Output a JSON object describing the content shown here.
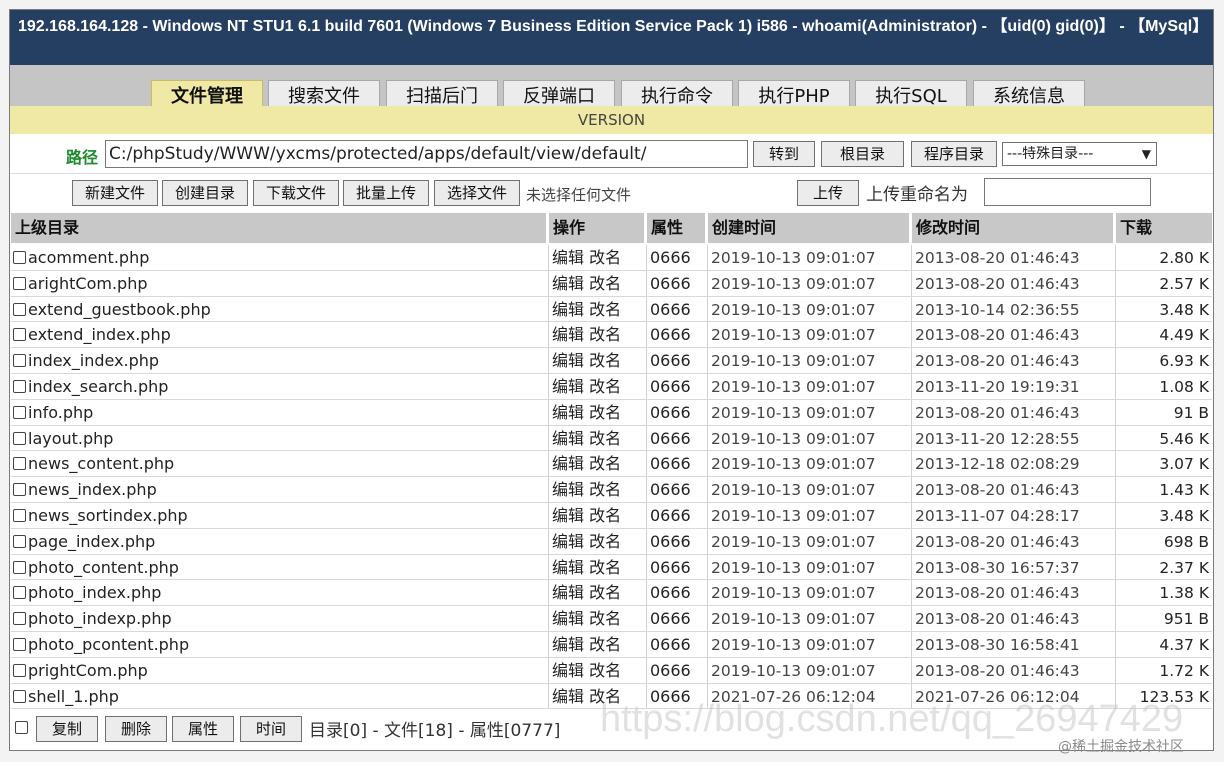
{
  "titlebar": {
    "text": "192.168.164.128 - Windows NT STU1 6.1 build 7601 (Windows 7 Business Edition Service Pack 1) i586 - whoami(Administrator) - 【uid(0) gid(0)】 - 【MySql】"
  },
  "tabs": [
    {
      "label": "文件管理",
      "active": true
    },
    {
      "label": "搜索文件",
      "active": false
    },
    {
      "label": "扫描后门",
      "active": false
    },
    {
      "label": "反弹端口",
      "active": false
    },
    {
      "label": "执行命令",
      "active": false
    },
    {
      "label": "执行PHP",
      "active": false
    },
    {
      "label": "执行SQL",
      "active": false
    },
    {
      "label": "系统信息",
      "active": false
    }
  ],
  "version": "VERSION",
  "path": {
    "label": "路径",
    "value": "C:/phpStudy/WWW/yxcms/protected/apps/default/view/default/",
    "goto_label": "转到",
    "root_label": "根目录",
    "program_label": "程序目录",
    "special_select": "---特殊目录---"
  },
  "toolbar": {
    "new_file": "新建文件",
    "new_dir": "创建目录",
    "download_file": "下载文件",
    "batch_upload": "批量上传",
    "choose_file": "选择文件",
    "no_file": "未选择任何文件",
    "upload": "上传",
    "rename_label": "上传重命名为"
  },
  "table": {
    "headers": [
      "上级目录",
      "操作",
      "属性",
      "创建时间",
      "修改时间",
      "下载"
    ],
    "edit_label": "编辑",
    "rename_label": "改名",
    "rows": [
      {
        "name": "acomment.php",
        "attr": "0666",
        "ctime": "2019-10-13 09:01:07",
        "mtime": "2013-08-20 01:46:43",
        "size": "2.80 K"
      },
      {
        "name": "arightCom.php",
        "attr": "0666",
        "ctime": "2019-10-13 09:01:07",
        "mtime": "2013-08-20 01:46:43",
        "size": "2.57 K"
      },
      {
        "name": "extend_guestbook.php",
        "attr": "0666",
        "ctime": "2019-10-13 09:01:07",
        "mtime": "2013-10-14 02:36:55",
        "size": "3.48 K"
      },
      {
        "name": "extend_index.php",
        "attr": "0666",
        "ctime": "2019-10-13 09:01:07",
        "mtime": "2013-08-20 01:46:43",
        "size": "4.49 K"
      },
      {
        "name": "index_index.php",
        "attr": "0666",
        "ctime": "2019-10-13 09:01:07",
        "mtime": "2013-08-20 01:46:43",
        "size": "6.93 K"
      },
      {
        "name": "index_search.php",
        "attr": "0666",
        "ctime": "2019-10-13 09:01:07",
        "mtime": "2013-11-20 19:19:31",
        "size": "1.08 K"
      },
      {
        "name": "info.php",
        "attr": "0666",
        "ctime": "2019-10-13 09:01:07",
        "mtime": "2013-08-20 01:46:43",
        "size": "91 B"
      },
      {
        "name": "layout.php",
        "attr": "0666",
        "ctime": "2019-10-13 09:01:07",
        "mtime": "2013-11-20 12:28:55",
        "size": "5.46 K"
      },
      {
        "name": "news_content.php",
        "attr": "0666",
        "ctime": "2019-10-13 09:01:07",
        "mtime": "2013-12-18 02:08:29",
        "size": "3.07 K"
      },
      {
        "name": "news_index.php",
        "attr": "0666",
        "ctime": "2019-10-13 09:01:07",
        "mtime": "2013-08-20 01:46:43",
        "size": "1.43 K"
      },
      {
        "name": "news_sortindex.php",
        "attr": "0666",
        "ctime": "2019-10-13 09:01:07",
        "mtime": "2013-11-07 04:28:17",
        "size": "3.48 K"
      },
      {
        "name": "page_index.php",
        "attr": "0666",
        "ctime": "2019-10-13 09:01:07",
        "mtime": "2013-08-20 01:46:43",
        "size": "698 B"
      },
      {
        "name": "photo_content.php",
        "attr": "0666",
        "ctime": "2019-10-13 09:01:07",
        "mtime": "2013-08-30 16:57:37",
        "size": "2.37 K"
      },
      {
        "name": "photo_index.php",
        "attr": "0666",
        "ctime": "2019-10-13 09:01:07",
        "mtime": "2013-08-20 01:46:43",
        "size": "1.38 K"
      },
      {
        "name": "photo_indexp.php",
        "attr": "0666",
        "ctime": "2019-10-13 09:01:07",
        "mtime": "2013-08-20 01:46:43",
        "size": "951 B"
      },
      {
        "name": "photo_pcontent.php",
        "attr": "0666",
        "ctime": "2019-10-13 09:01:07",
        "mtime": "2013-08-30 16:58:41",
        "size": "4.37 K"
      },
      {
        "name": "prightCom.php",
        "attr": "0666",
        "ctime": "2019-10-13 09:01:07",
        "mtime": "2013-08-20 01:46:43",
        "size": "1.72 K"
      },
      {
        "name": "shell_1.php",
        "attr": "0666",
        "ctime": "2021-07-26 06:12:04",
        "mtime": "2021-07-26 06:12:04",
        "size": "123.53 K"
      }
    ]
  },
  "footer": {
    "copy": "复制",
    "delete": "删除",
    "attr": "属性",
    "time": "时间",
    "summary": "目录[0] - 文件[18] - 属性[0777]"
  },
  "watermark": {
    "url": "https://blog.csdn.net/qq_26947429",
    "credit": "@稀土掘金技术社区"
  }
}
